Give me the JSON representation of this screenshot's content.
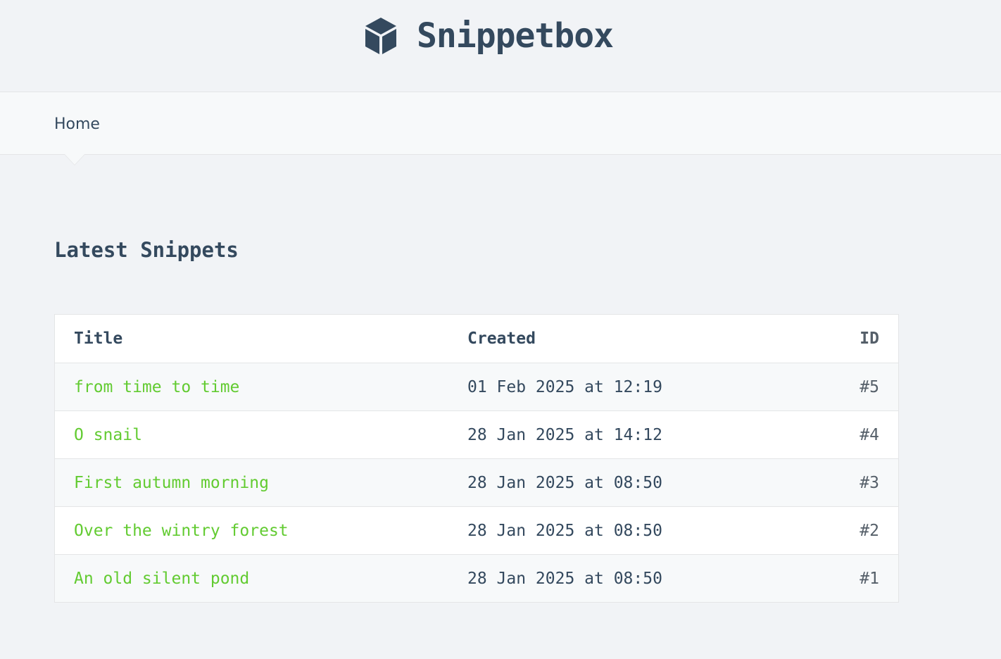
{
  "app": {
    "name": "Snippetbox",
    "brand_icon": "cube-icon"
  },
  "nav": {
    "home_label": "Home"
  },
  "page": {
    "heading": "Latest Snippets"
  },
  "table": {
    "headers": {
      "title": "Title",
      "created": "Created",
      "id": "ID"
    },
    "rows": [
      {
        "title": "from time to time",
        "created": "01 Feb 2025 at 12:19",
        "id": "#5"
      },
      {
        "title": "O snail",
        "created": "28 Jan 2025 at 14:12",
        "id": "#4"
      },
      {
        "title": "First autumn morning",
        "created": "28 Jan 2025 at 08:50",
        "id": "#3"
      },
      {
        "title": "Over the wintry forest",
        "created": "28 Jan 2025 at 08:50",
        "id": "#2"
      },
      {
        "title": "An old silent pond",
        "created": "28 Jan 2025 at 08:50",
        "id": "#1"
      }
    ]
  },
  "colors": {
    "text": "#34495e",
    "link": "#62cb31",
    "background": "#f1f3f6",
    "nav_background": "#f7f9fa",
    "border": "#e4e5e7"
  }
}
